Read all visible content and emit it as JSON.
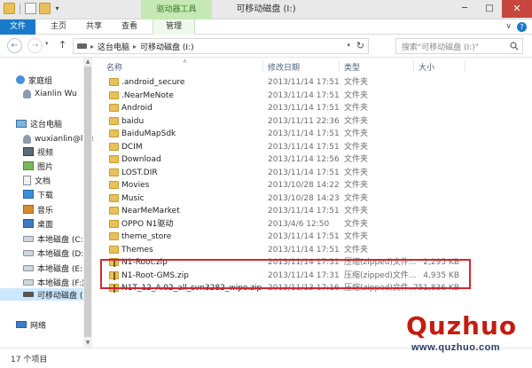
{
  "titlebar": {
    "context_tab": "驱动器工具",
    "window_title": "可移动磁盘 (I:)",
    "min_glyph": "─",
    "max_glyph": "□",
    "close_glyph": "✕",
    "qat_chevron": "▾"
  },
  "ribbon": {
    "tabs": [
      {
        "label": "文件"
      },
      {
        "label": "主页"
      },
      {
        "label": "共享"
      },
      {
        "label": "查看"
      },
      {
        "label": "管理"
      }
    ],
    "collapse_glyph": "∨",
    "help_glyph": "?"
  },
  "address": {
    "crumbs": [
      "这台电脑",
      "可移动磁盘 (I:)"
    ],
    "sep": "▸",
    "dd_glyph": "▾",
    "refresh_glyph": "↻",
    "back_glyph": "←",
    "fwd_glyph": "→",
    "up_glyph": "↑",
    "search_placeholder": "搜索\"可移动磁盘 (I:)\""
  },
  "navpane": {
    "items": [
      {
        "label": "家庭组",
        "icon": "homegroup-icon"
      },
      {
        "label": "Xianlin Wu",
        "icon": "user-icon"
      },
      {
        "label": "这台电脑",
        "icon": "computer-icon"
      },
      {
        "label": "wuxianlin@live",
        "icon": "user-icon"
      },
      {
        "label": "视频",
        "icon": "video-icon"
      },
      {
        "label": "图片",
        "icon": "pictures-icon"
      },
      {
        "label": "文档",
        "icon": "documents-icon"
      },
      {
        "label": "下载",
        "icon": "downloads-icon"
      },
      {
        "label": "音乐",
        "icon": "music-icon"
      },
      {
        "label": "桌面",
        "icon": "desktop-icon"
      },
      {
        "label": "本地磁盘 (C:)",
        "icon": "drive-icon"
      },
      {
        "label": "本地磁盘 (D:)",
        "icon": "drive-icon"
      },
      {
        "label": "本地磁盘 (E:)",
        "icon": "drive-icon"
      },
      {
        "label": "本地磁盘 (F:)",
        "icon": "drive-icon"
      },
      {
        "label": "可移动磁盘 (I:)",
        "icon": "usb-drive-icon"
      },
      {
        "label": "网络",
        "icon": "network-icon"
      }
    ]
  },
  "filelist": {
    "columns": {
      "name": "名称",
      "date": "修改日期",
      "type": "类型",
      "size": "大小"
    },
    "sort_glyph": "∧",
    "rows": [
      {
        "name": ".android_secure",
        "date": "2013/11/14 17:51",
        "type": "文件夹",
        "size": "",
        "kind": "folder"
      },
      {
        "name": ".NearMeNote",
        "date": "2013/11/14 17:51",
        "type": "文件夹",
        "size": "",
        "kind": "folder"
      },
      {
        "name": "Android",
        "date": "2013/11/14 17:51",
        "type": "文件夹",
        "size": "",
        "kind": "folder"
      },
      {
        "name": "baidu",
        "date": "2013/11/11 22:36",
        "type": "文件夹",
        "size": "",
        "kind": "folder"
      },
      {
        "name": "BaiduMapSdk",
        "date": "2013/11/14 17:51",
        "type": "文件夹",
        "size": "",
        "kind": "folder"
      },
      {
        "name": "DCIM",
        "date": "2013/11/14 17:51",
        "type": "文件夹",
        "size": "",
        "kind": "folder"
      },
      {
        "name": "Download",
        "date": "2013/11/14 12:56",
        "type": "文件夹",
        "size": "",
        "kind": "folder"
      },
      {
        "name": "LOST.DIR",
        "date": "2013/11/14 17:51",
        "type": "文件夹",
        "size": "",
        "kind": "folder"
      },
      {
        "name": "Movies",
        "date": "2013/10/28 14:22",
        "type": "文件夹",
        "size": "",
        "kind": "folder"
      },
      {
        "name": "Music",
        "date": "2013/10/28 14:23",
        "type": "文件夹",
        "size": "",
        "kind": "folder"
      },
      {
        "name": "NearMeMarket",
        "date": "2013/11/14 17:51",
        "type": "文件夹",
        "size": "",
        "kind": "folder"
      },
      {
        "name": "OPPO N1驱动",
        "date": "2013/4/6 12:50",
        "type": "文件夹",
        "size": "",
        "kind": "folder"
      },
      {
        "name": "theme_store",
        "date": "2013/11/14 17:51",
        "type": "文件夹",
        "size": "",
        "kind": "folder"
      },
      {
        "name": "Themes",
        "date": "2013/11/14 17:51",
        "type": "文件夹",
        "size": "",
        "kind": "folder"
      },
      {
        "name": "N1-Root.zip",
        "date": "2013/11/14 17:31",
        "type": "压缩(zipped)文件...",
        "size": "2,295 KB",
        "kind": "zip"
      },
      {
        "name": "N1-Root-GMS.zip",
        "date": "2013/11/14 17:31",
        "type": "压缩(zipped)文件...",
        "size": "4,935 KB",
        "kind": "zip"
      },
      {
        "name": "N1T_12_A.02_all_svn3282_wipe.zip",
        "date": "2013/11/13 17:16",
        "type": "压缩(zipped)文件...",
        "size": "751,836 KB",
        "kind": "zip"
      }
    ]
  },
  "status": {
    "count": "17 个项目"
  },
  "watermark": {
    "brand": "Quzhuo",
    "url": "www.quzhuo.com"
  },
  "colors": {
    "accent": "#1979ca",
    "context": "#c5e8b5",
    "close": "#c7463d",
    "highlight": "#d3262e",
    "watermark": "#c41d0f"
  }
}
